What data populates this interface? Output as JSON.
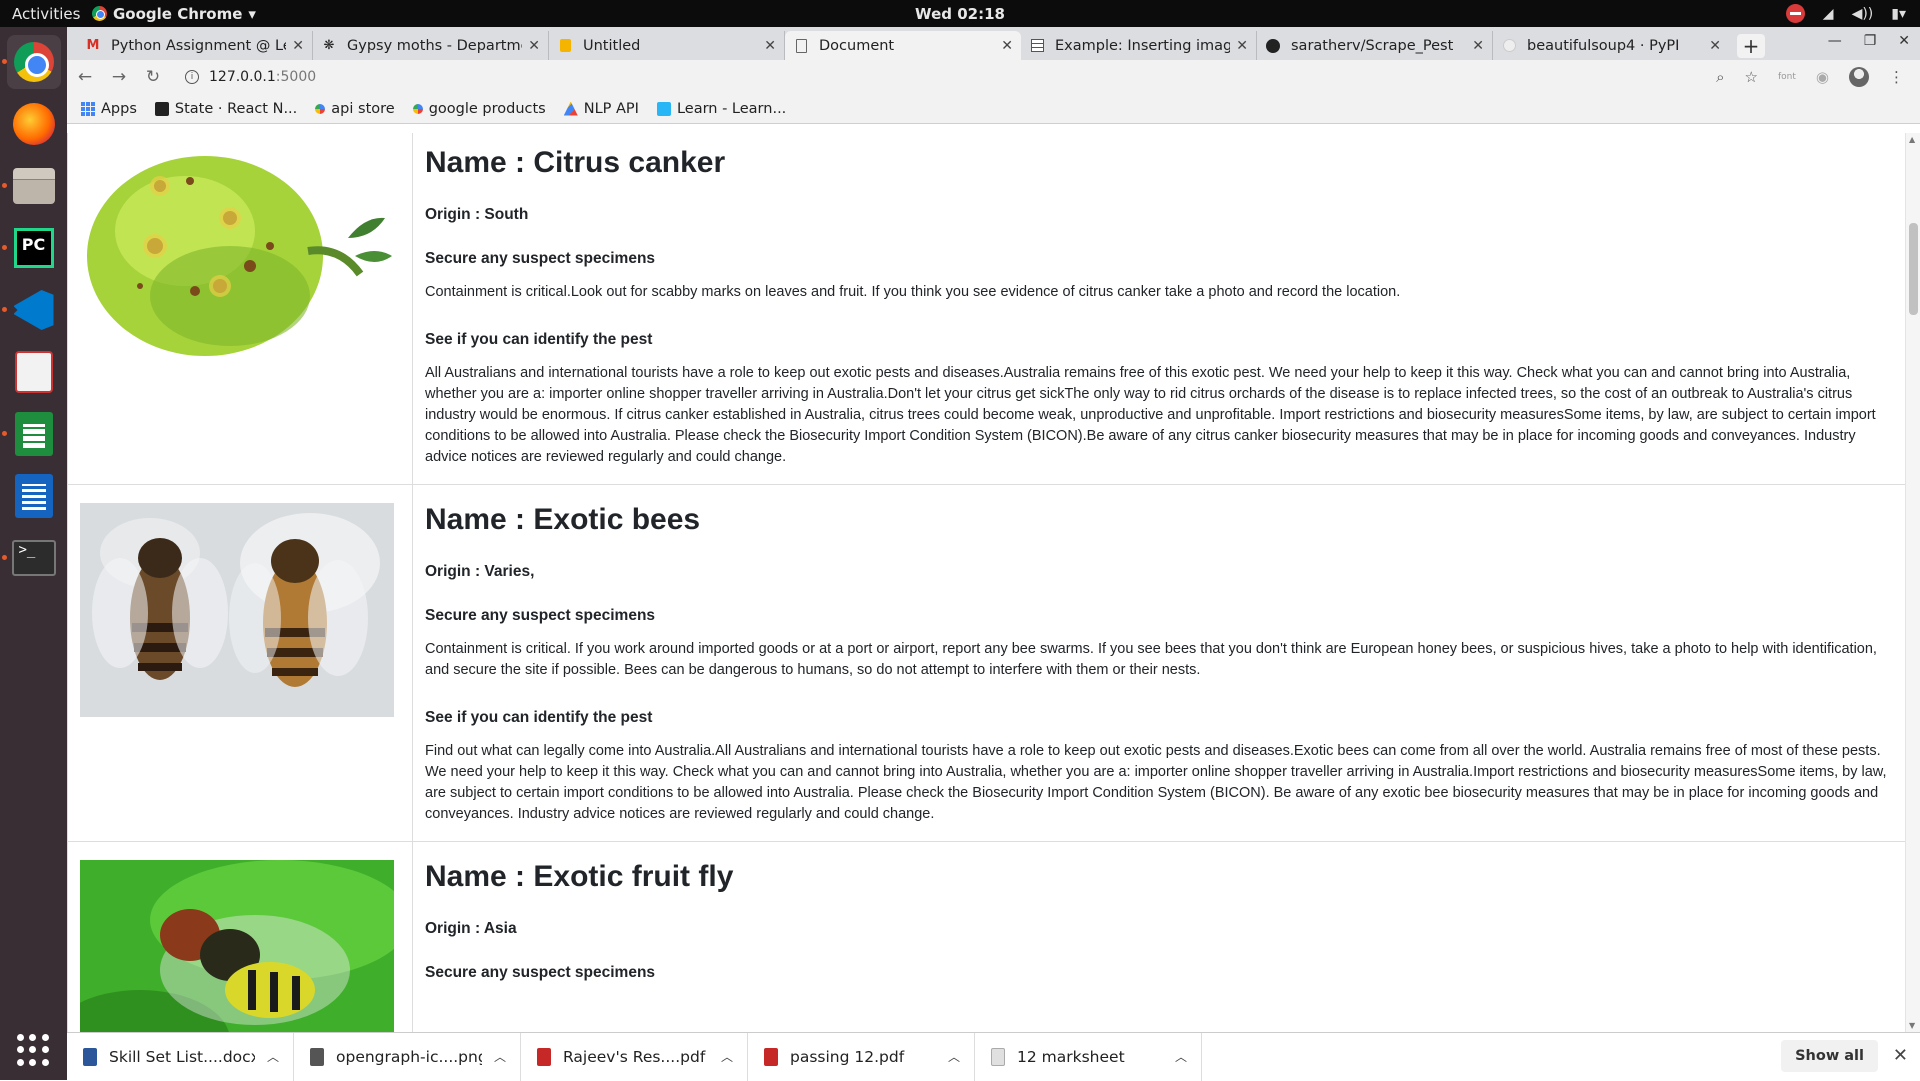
{
  "system": {
    "activities": "Activities",
    "app_name": "Google Chrome",
    "clock": "Wed 02:18"
  },
  "tabs": [
    {
      "title": "Python Assignment @ Le",
      "icon": "gmail-icon",
      "active": false
    },
    {
      "title": "Gypsy moths - Departmen",
      "icon": "moth-icon",
      "active": false
    },
    {
      "title": "Untitled",
      "icon": "document-icon",
      "active": false
    },
    {
      "title": "Document",
      "icon": "page-icon",
      "active": true
    },
    {
      "title": "Example: Inserting image",
      "icon": "table-icon",
      "active": false
    },
    {
      "title": "saratherv/Scrape_Pest",
      "icon": "github-icon",
      "active": false
    },
    {
      "title": "beautifulsoup4 · PyPI",
      "icon": "pypi-icon",
      "active": false
    }
  ],
  "address_bar": {
    "host": "127.0.0.1",
    "port": ":5000"
  },
  "bookmarks": [
    {
      "label": "Apps",
      "icon": "apps-icon"
    },
    {
      "label": "State · React N...",
      "icon": "react-icon"
    },
    {
      "label": "api store",
      "icon": "google-icon"
    },
    {
      "label": "google products",
      "icon": "google-icon"
    },
    {
      "label": "NLP API",
      "icon": "nlp-icon"
    },
    {
      "label": "Learn - Learn...",
      "icon": "learn-icon"
    }
  ],
  "pests": [
    {
      "name": "Name : Citrus canker",
      "origin": "Origin : South",
      "secure_head": "Secure any suspect specimens",
      "secure_body": "Containment is critical.Look out for scabby marks on leaves and fruit. If you think you see evidence of citrus canker take a photo and record the location.",
      "identify_head": "See if you can identify the pest",
      "identify_body": "All Australians and international tourists have a role to keep out exotic pests and diseases.Australia remains free of this exotic pest. We need your help to keep it this way. Check what you can and cannot bring into Australia, whether you are a: importer online shopper traveller arriving in Australia.Don't let your citrus get sickThe only way to rid citrus orchards of the disease is to replace infected trees, so the cost of an outbreak to Australia's citrus industry would be enormous. If citrus canker established in Australia, citrus trees could become weak, unproductive and unprofitable. Import restrictions and biosecurity measuresSome items, by law, are subject to certain import conditions to be allowed into Australia. Please check the Biosecurity Import Condition System (BICON).Be aware of any citrus canker biosecurity measures that may be in place for incoming goods and conveyances. Industry advice notices are reviewed regularly and could change."
    },
    {
      "name": "Name : Exotic bees",
      "origin": "Origin : Varies,",
      "secure_head": "Secure any suspect specimens",
      "secure_body": "Containment is critical. If you work around imported goods or at a port or airport, report any bee swarms. If you see bees that you don't think are European honey bees, or suspicious hives, take a photo to help with identification, and secure the site if possible. Bees can be dangerous to humans, so do not attempt to interfere with them or their nests.",
      "identify_head": "See if you can identify the pest",
      "identify_body": "Find out what can legally come into Australia.All Australians and international tourists have a role to keep out exotic pests and diseases.Exotic bees can come from all over the world. Australia remains free of most of these pests. We need your help to keep it this way. Check what you can and cannot bring into Australia, whether you are a: importer online shopper traveller arriving in Australia.Import restrictions and biosecurity measuresSome items, by law, are subject to certain import conditions to be allowed into Australia. Please check the Biosecurity Import Condition System (BICON). Be aware of any exotic bee biosecurity measures that may be in place for incoming goods and conveyances. Industry advice notices are reviewed regularly and could change."
    },
    {
      "name": "Name : Exotic fruit fly",
      "origin": "Origin : Asia",
      "secure_head": "Secure any suspect specimens",
      "secure_body": "",
      "identify_head": "",
      "identify_body": ""
    }
  ],
  "downloads": [
    {
      "name": "Skill Set List....docx",
      "type": "doc"
    },
    {
      "name": "opengraph-ic....png",
      "type": "img"
    },
    {
      "name": "Rajeev's Res....pdf",
      "type": "pdf"
    },
    {
      "name": "passing 12.pdf",
      "type": "pdf"
    },
    {
      "name": "12 marksheet",
      "type": "gen"
    }
  ],
  "show_all": "Show all"
}
